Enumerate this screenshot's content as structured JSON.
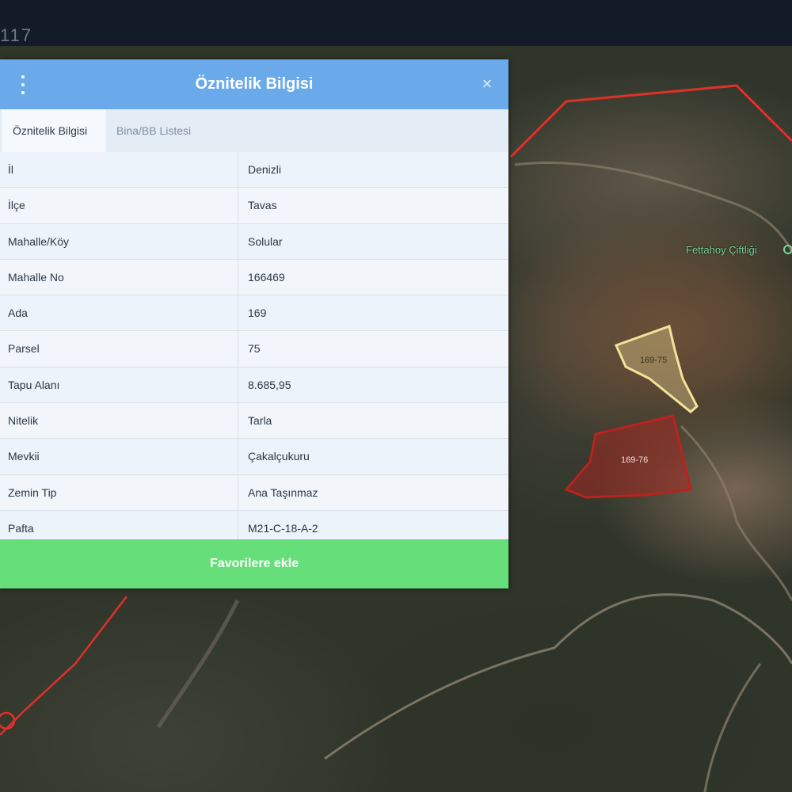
{
  "top_bar": {
    "number": "117"
  },
  "map": {
    "place_label": "Fettahoy Çiftliği",
    "parcel_yellow_label": "169-75",
    "parcel_red_label": "169-76",
    "boundary_color": "#e0302a",
    "parcel_yellow_color": "#f3e39a",
    "parcel_red_color": "#b8231f"
  },
  "dialog": {
    "title": "Öznitelik Bilgisi",
    "menu_icon": "kebab-menu-icon",
    "close_icon": "close-icon",
    "close_label": "×",
    "tabs": [
      {
        "label": "Öznitelik Bilgisi",
        "active": true
      },
      {
        "label": "Bina/BB Listesi",
        "active": false
      }
    ],
    "rows": [
      {
        "key": "İl",
        "value": "Denizli"
      },
      {
        "key": "İlçe",
        "value": "Tavas"
      },
      {
        "key": "Mahalle/Köy",
        "value": "Solular"
      },
      {
        "key": "Mahalle No",
        "value": "166469"
      },
      {
        "key": "Ada",
        "value": "169"
      },
      {
        "key": "Parsel",
        "value": "75"
      },
      {
        "key": "Tapu Alanı",
        "value": "8.685,95"
      },
      {
        "key": "Nitelik",
        "value": "Tarla"
      },
      {
        "key": "Mevkii",
        "value": "Çakalçukuru"
      },
      {
        "key": "Zemin Tip",
        "value": "Ana Taşınmaz"
      },
      {
        "key": "Pafta",
        "value": "M21-C-18-A-2"
      }
    ],
    "favorite_button": "Favorilere ekle",
    "header_color": "#6aaaeb",
    "button_color": "#66df7a"
  }
}
